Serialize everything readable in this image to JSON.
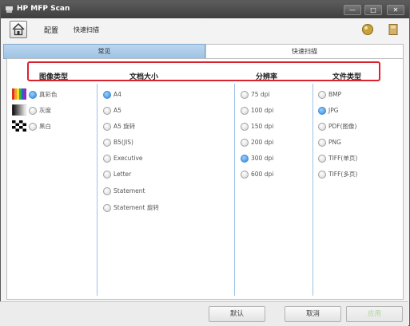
{
  "window": {
    "title": "HP MFP Scan",
    "minimize": "—",
    "maximize": "□",
    "close": "✕"
  },
  "toolbar": {
    "crumb_main": "配置",
    "crumb_sub": "快速扫描",
    "icons": [
      "home-icon",
      "help-icon",
      "book-icon"
    ]
  },
  "tabs": [
    {
      "label": "常见",
      "active": false
    },
    {
      "label": "快速扫描",
      "active": true
    }
  ],
  "columns": {
    "image_type": {
      "header": "图像类型",
      "options": [
        {
          "label": "真彩色",
          "selected": true
        },
        {
          "label": "灰度",
          "selected": false
        },
        {
          "label": "黑白",
          "selected": false
        }
      ]
    },
    "doc_size": {
      "header": "文档大小",
      "options": [
        {
          "label": "A4",
          "selected": true
        },
        {
          "label": "A5",
          "selected": false
        },
        {
          "label": "A5 旋转",
          "selected": false
        },
        {
          "label": "B5(JIS)",
          "selected": false
        },
        {
          "label": "Executive",
          "selected": false
        },
        {
          "label": "Letter",
          "selected": false
        },
        {
          "label": "Statement",
          "selected": false
        },
        {
          "label": "Statement 旋转",
          "selected": false
        }
      ]
    },
    "resolution": {
      "header": "分辨率",
      "options": [
        {
          "label": "75 dpi",
          "selected": false
        },
        {
          "label": "100 dpi",
          "selected": false
        },
        {
          "label": "150 dpi",
          "selected": false
        },
        {
          "label": "200 dpi",
          "selected": false
        },
        {
          "label": "300 dpi",
          "selected": true
        },
        {
          "label": "600 dpi",
          "selected": false
        }
      ]
    },
    "file_type": {
      "header": "文件类型",
      "options": [
        {
          "label": "BMP",
          "selected": false
        },
        {
          "label": "JPG",
          "selected": true
        },
        {
          "label": "PDF(图像)",
          "selected": false
        },
        {
          "label": "PNG",
          "selected": false
        },
        {
          "label": "TIFF(单页)",
          "selected": false
        },
        {
          "label": "TIFF(多页)",
          "selected": false
        }
      ]
    }
  },
  "buttons": {
    "default": "默认",
    "cancel": "取消",
    "apply": "应用"
  },
  "colors": {
    "accent": "#2f86d6",
    "highlight_box": "#d9232e",
    "tab_active": "#9ec3e6"
  }
}
